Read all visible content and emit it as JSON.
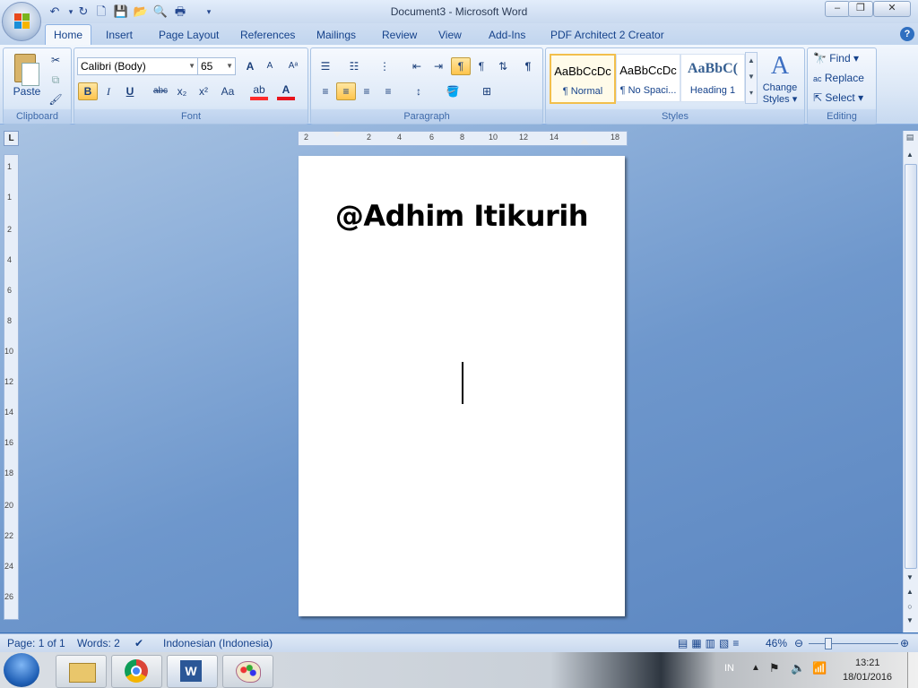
{
  "window": {
    "title": "Document3 - Microsoft Word",
    "minimize": "–",
    "maximize": "❐",
    "close": "✕"
  },
  "tabs": [
    {
      "label": "Home"
    },
    {
      "label": "Insert"
    },
    {
      "label": "Page Layout"
    },
    {
      "label": "References"
    },
    {
      "label": "Mailings"
    },
    {
      "label": "Review"
    },
    {
      "label": "View"
    },
    {
      "label": "Add-Ins"
    },
    {
      "label": "PDF Architect 2 Creator"
    }
  ],
  "ribbon": {
    "clipboard": {
      "label": "Clipboard",
      "paste": "Paste"
    },
    "font": {
      "label": "Font",
      "family": "Calibri (Body)",
      "size": "65",
      "bold": "B",
      "italic": "I",
      "underline": "U",
      "strike": "abc",
      "subscript": "x₂",
      "superscript": "x²",
      "case": "Aa",
      "grow": "A",
      "shrink": "A"
    },
    "paragraph": {
      "label": "Paragraph",
      "pilcrow": "¶"
    },
    "styles": {
      "label": "Styles",
      "items": [
        {
          "preview": "AaBbCcDc",
          "name": "¶ Normal",
          "selected": true
        },
        {
          "preview": "AaBbCcDc",
          "name": "¶ No Spaci...",
          "selected": false
        },
        {
          "preview": "AaBbC(",
          "name": "Heading 1",
          "selected": false
        }
      ],
      "change_line1": "Change",
      "change_line2": "Styles"
    },
    "editing": {
      "label": "Editing",
      "find": "Find",
      "replace": "Replace",
      "select": "Select"
    }
  },
  "ruler": {
    "top": [
      "2",
      "2",
      "4",
      "6",
      "8",
      "10",
      "12",
      "14",
      "18"
    ],
    "left": [
      "1",
      "1",
      "2",
      "4",
      "6",
      "8",
      "10",
      "12",
      "14",
      "16",
      "18",
      "20",
      "22",
      "24",
      "26"
    ]
  },
  "document": {
    "title": "@Adhim Itikurih"
  },
  "status": {
    "page": "Page: 1 of 1",
    "words": "Words: 2",
    "language": "Indonesian (Indonesia)",
    "zoom": "46%"
  },
  "taskbar": {
    "lang": "IN",
    "time": "13:21",
    "date": "18/01/2016"
  }
}
